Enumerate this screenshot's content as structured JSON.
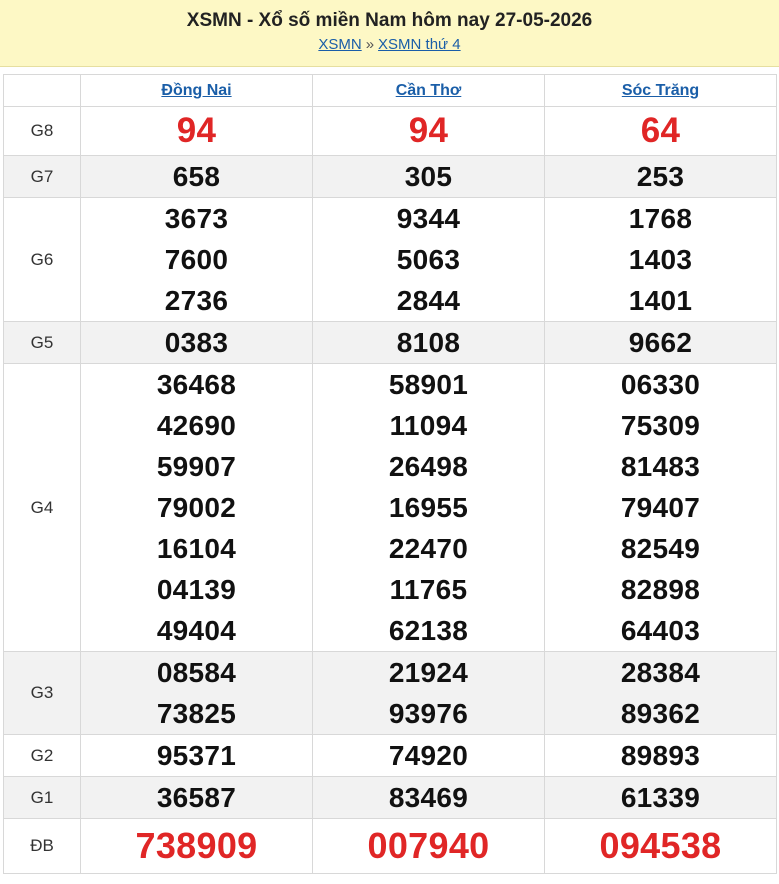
{
  "header": {
    "title": "XSMN - Xổ số miền Nam hôm nay 27-05-2026",
    "breadcrumb": {
      "home": "XSMN",
      "separator": "»",
      "current": "XSMN thứ 4"
    }
  },
  "provinces": [
    "Đồng Nai",
    "Cần Thơ",
    "Sóc Trăng"
  ],
  "colors": {
    "accent_red": "#e02626",
    "link_blue": "#1a5ea8",
    "header_bg": "#fdf8c5",
    "row_shade": "#f2f2f2"
  },
  "prizes": {
    "g8": {
      "label": "G8",
      "values": [
        [
          "94"
        ],
        [
          "94"
        ],
        [
          "64"
        ]
      ]
    },
    "g7": {
      "label": "G7",
      "values": [
        [
          "658"
        ],
        [
          "305"
        ],
        [
          "253"
        ]
      ]
    },
    "g6": {
      "label": "G6",
      "values": [
        [
          "3673",
          "7600",
          "2736"
        ],
        [
          "9344",
          "5063",
          "2844"
        ],
        [
          "1768",
          "1403",
          "1401"
        ]
      ]
    },
    "g5": {
      "label": "G5",
      "values": [
        [
          "0383"
        ],
        [
          "8108"
        ],
        [
          "9662"
        ]
      ]
    },
    "g4": {
      "label": "G4",
      "values": [
        [
          "36468",
          "42690",
          "59907",
          "79002",
          "16104",
          "04139",
          "49404"
        ],
        [
          "58901",
          "11094",
          "26498",
          "16955",
          "22470",
          "11765",
          "62138"
        ],
        [
          "06330",
          "75309",
          "81483",
          "79407",
          "82549",
          "82898",
          "64403"
        ]
      ]
    },
    "g3": {
      "label": "G3",
      "values": [
        [
          "08584",
          "73825"
        ],
        [
          "21924",
          "93976"
        ],
        [
          "28384",
          "89362"
        ]
      ]
    },
    "g2": {
      "label": "G2",
      "values": [
        [
          "95371"
        ],
        [
          "74920"
        ],
        [
          "89893"
        ]
      ]
    },
    "g1": {
      "label": "G1",
      "values": [
        [
          "36587"
        ],
        [
          "83469"
        ],
        [
          "61339"
        ]
      ]
    },
    "db": {
      "label": "ĐB",
      "values": [
        [
          "738909"
        ],
        [
          "007940"
        ],
        [
          "094538"
        ]
      ]
    }
  }
}
